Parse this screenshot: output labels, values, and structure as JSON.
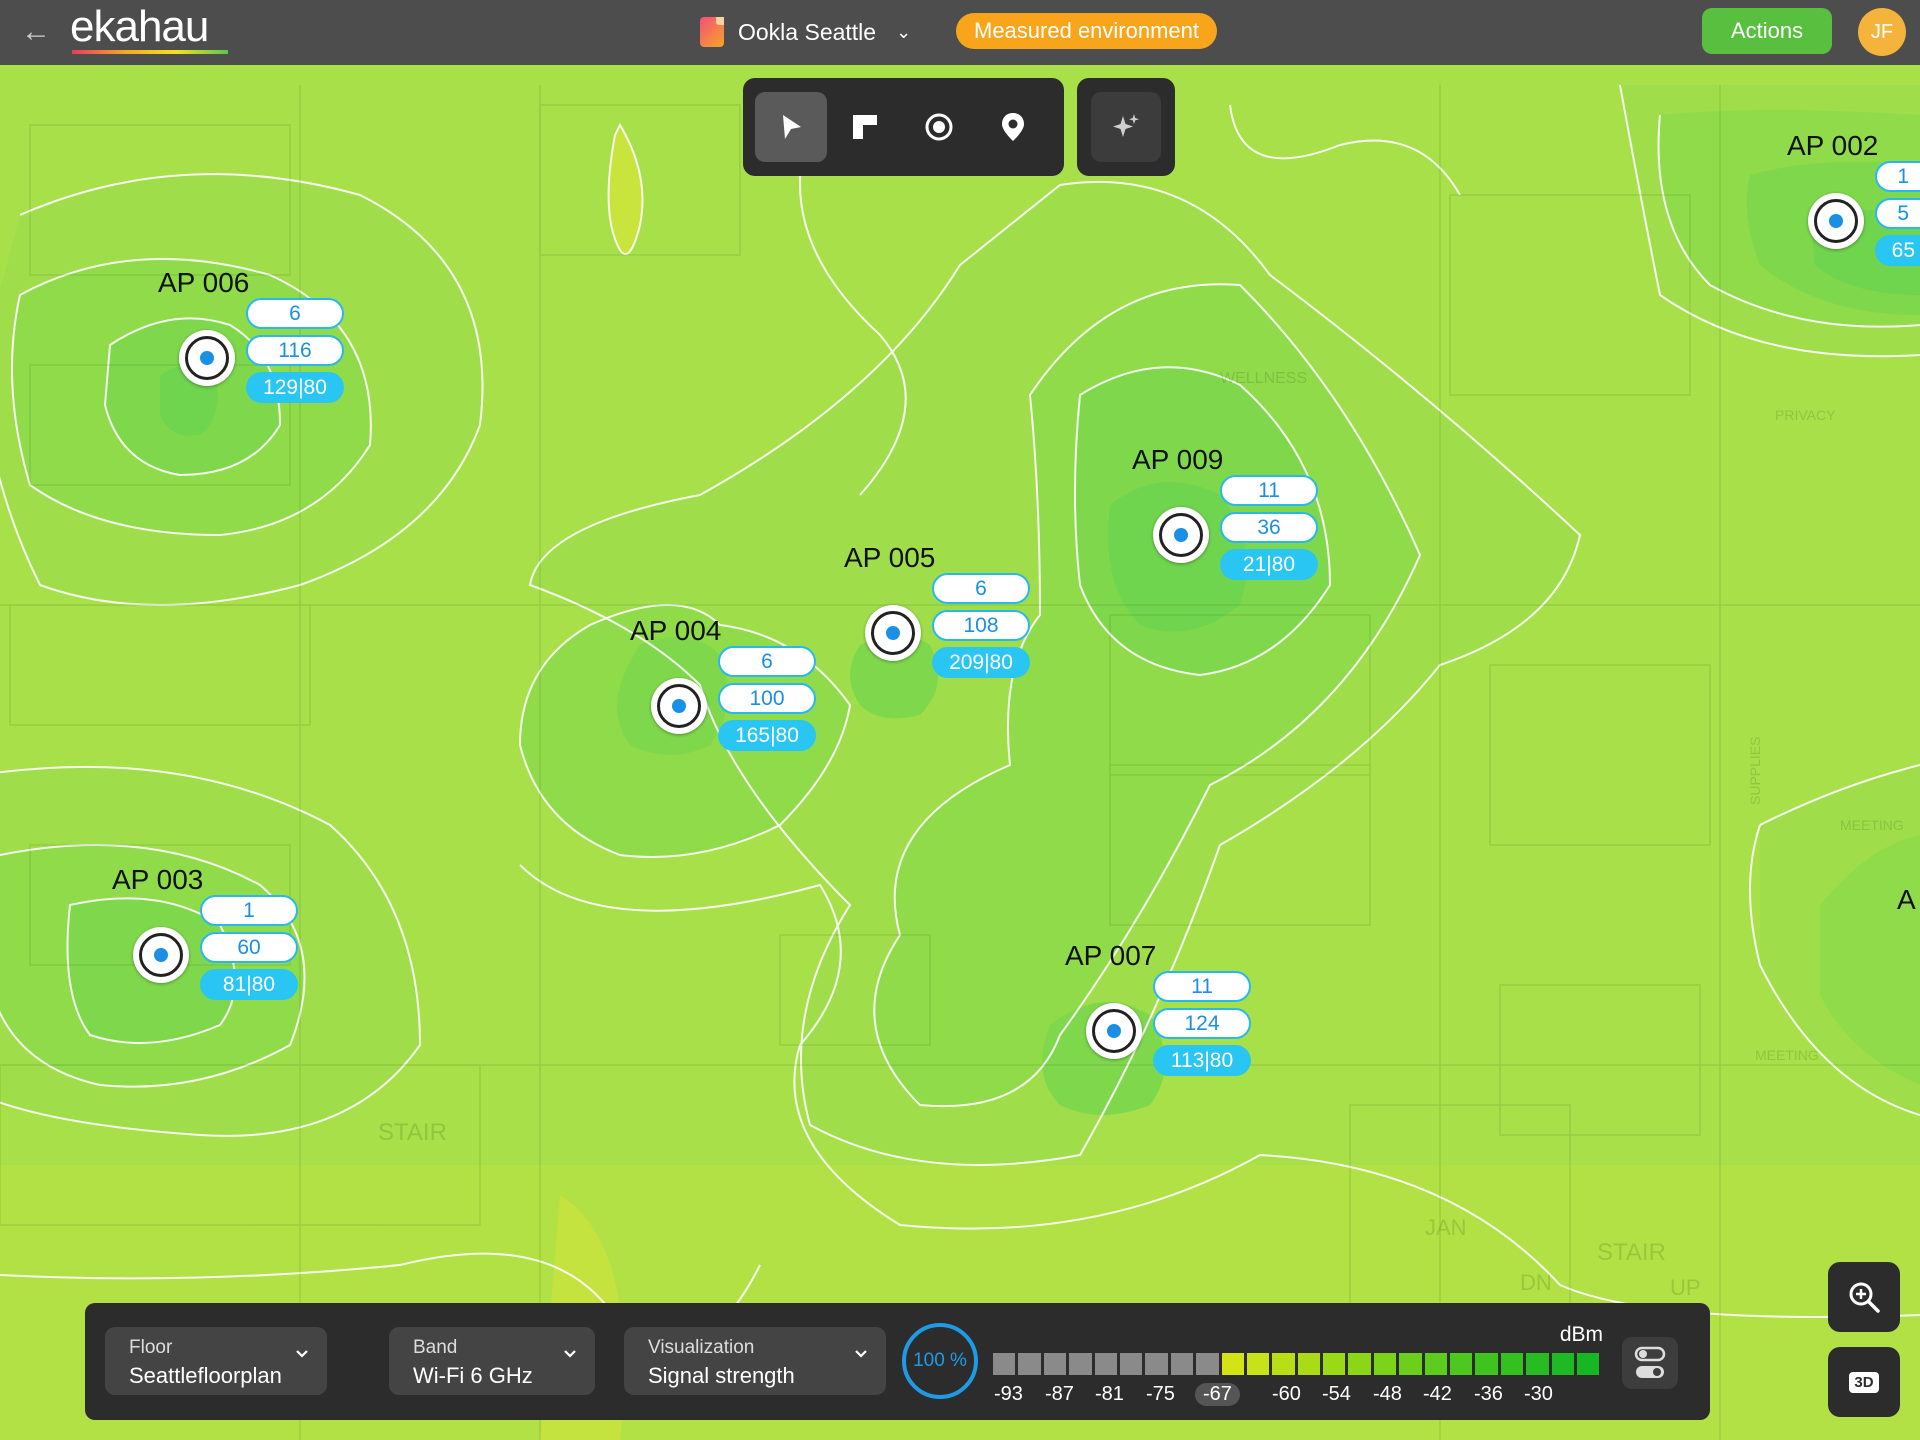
{
  "header": {
    "back_icon": "arrow-left-icon",
    "logo_text": "ekahau",
    "project_name": "Ookla Seattle",
    "environment_badge": "Measured environment",
    "actions_label": "Actions",
    "avatar_initials": "JF",
    "colors": {
      "bar": "#4d4d4d",
      "badge": "#f8a51b",
      "actions": "#58c03e",
      "avatar": "#f4b33a"
    }
  },
  "tools": [
    {
      "name": "select-tool",
      "icon": "pointer-icon",
      "active": true
    },
    {
      "name": "area-tool",
      "icon": "area-icon",
      "active": false
    },
    {
      "name": "ap-tool",
      "icon": "ap-circle-icon",
      "active": false
    },
    {
      "name": "pin-tool",
      "icon": "map-pin-icon",
      "active": false
    }
  ],
  "magic_tool_icon": "sparkle-icon",
  "access_points": [
    {
      "name": "AP 006",
      "channel": "6",
      "count": "116",
      "ratio": "129|80"
    },
    {
      "name": "AP 002",
      "channel": "1",
      "count": "5",
      "ratio": "65"
    },
    {
      "name": "AP 009",
      "channel": "11",
      "count": "36",
      "ratio": "21|80"
    },
    {
      "name": "AP 005",
      "channel": "6",
      "count": "108",
      "ratio": "209|80"
    },
    {
      "name": "AP 004",
      "channel": "6",
      "count": "100",
      "ratio": "165|80"
    },
    {
      "name": "AP 003",
      "channel": "1",
      "count": "60",
      "ratio": "81|80"
    },
    {
      "name": "AP 007",
      "channel": "11",
      "count": "124",
      "ratio": "113|80"
    },
    {
      "name": "A"
    }
  ],
  "floorplan_labels": {
    "stair_1": "STAIR",
    "stair_2": "STAIR",
    "jan": "JAN",
    "wellness": "WELLNESS",
    "privacy": "PRIVACY",
    "meeting_1": "MEETING",
    "meeting_2": "MEETING",
    "dn": "DN",
    "up": "UP",
    "supplies": "SUPPLIES"
  },
  "controls": {
    "floor": {
      "label": "Floor",
      "value": "Seattlefloorplan"
    },
    "band": {
      "label": "Band",
      "value": "Wi-Fi 6 GHz"
    },
    "visualization": {
      "label": "Visualization",
      "value": "Signal strength"
    },
    "opacity": "100 %",
    "legend": {
      "unit": "dBm",
      "ticks": [
        "-93",
        "-87",
        "-81",
        "-75",
        "-67",
        "-60",
        "-54",
        "-48",
        "-42",
        "-36",
        "-30"
      ],
      "threshold": "-67",
      "colors_inactive": "#8a8a8a",
      "colors_active": [
        "#d4e316",
        "#c7e216",
        "#b8df16",
        "#a9dc16",
        "#9ad916",
        "#8ad617",
        "#7bd31a",
        "#6ccf1c",
        "#5ccc1d",
        "#4dc81e",
        "#3fc41f",
        "#33c120",
        "#27bd22",
        "#1fba23",
        "#17b724"
      ]
    },
    "toggle_icon": "toggle-switches-icon"
  },
  "zoom_icon": "zoom-in-icon",
  "threed_label": "3D"
}
